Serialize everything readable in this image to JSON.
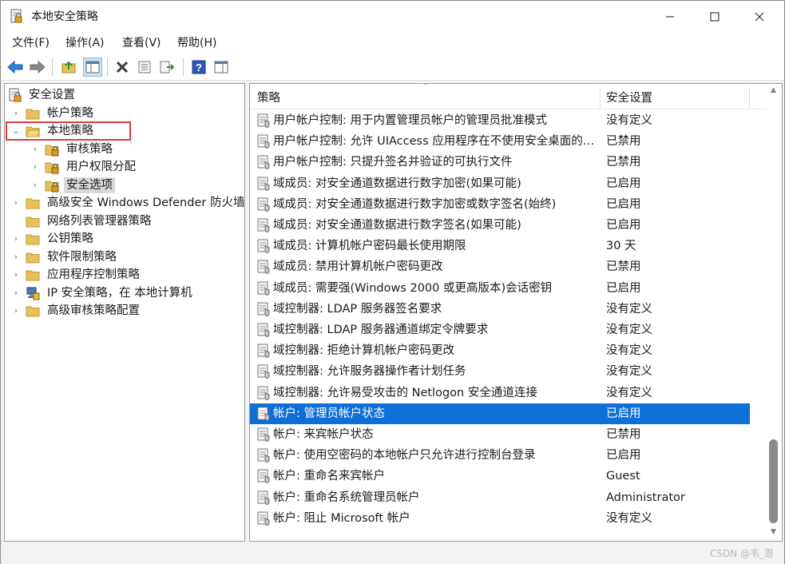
{
  "window": {
    "title": "本地安全策略"
  },
  "menu": [
    "文件(F)",
    "操作(A)",
    "查看(V)",
    "帮助(H)"
  ],
  "toolbar": {
    "icons": [
      "back-arrow-icon",
      "forward-arrow-icon",
      "up-folder-icon",
      "show-hide-tree-icon",
      "delete-icon",
      "properties-icon",
      "export-list-icon",
      "help-icon",
      "show-hide-action-pane-icon"
    ]
  },
  "tree": {
    "items": [
      {
        "label": "安全设置",
        "level": 0,
        "arrow": "",
        "icon": "security-settings-icon"
      },
      {
        "label": "帐户策略",
        "level": 1,
        "arrow": "›",
        "icon": "folder-icon"
      },
      {
        "label": "本地策略",
        "level": 1,
        "arrow": "⌄",
        "icon": "folder-open-icon"
      },
      {
        "label": "审核策略",
        "level": 2,
        "arrow": "›",
        "icon": "folder-locked-icon"
      },
      {
        "label": "用户权限分配",
        "level": 2,
        "arrow": "›",
        "icon": "folder-locked-icon"
      },
      {
        "label": "安全选项",
        "level": 2,
        "arrow": "›",
        "icon": "folder-locked-icon",
        "selected": true
      },
      {
        "label": "高级安全 Windows Defender 防火墙",
        "level": 1,
        "arrow": "›",
        "icon": "folder-icon"
      },
      {
        "label": "网络列表管理器策略",
        "level": 1,
        "arrow": "",
        "icon": "folder-icon"
      },
      {
        "label": "公钥策略",
        "level": 1,
        "arrow": "›",
        "icon": "folder-icon"
      },
      {
        "label": "软件限制策略",
        "level": 1,
        "arrow": "›",
        "icon": "folder-icon"
      },
      {
        "label": "应用程序控制策略",
        "level": 1,
        "arrow": "›",
        "icon": "folder-icon"
      },
      {
        "label": "IP 安全策略，在 本地计算机",
        "level": 1,
        "arrow": "›",
        "icon": "ip-security-icon"
      },
      {
        "label": "高级审核策略配置",
        "level": 1,
        "arrow": "›",
        "icon": "folder-icon"
      }
    ]
  },
  "list": {
    "columns": {
      "policy": "策略",
      "setting": "安全设置"
    },
    "rows": [
      {
        "policy": "用户帐户控制: 用于内置管理员帐户的管理员批准模式",
        "setting": "没有定义"
      },
      {
        "policy": "用户帐户控制: 允许 UIAccess 应用程序在不使用安全桌面的情况下提升权限",
        "setting": "已禁用"
      },
      {
        "policy": "用户帐户控制: 只提升签名并验证的可执行文件",
        "setting": "已禁用"
      },
      {
        "policy": "域成员: 对安全通道数据进行数字加密(如果可能)",
        "setting": "已启用"
      },
      {
        "policy": "域成员: 对安全通道数据进行数字加密或数字签名(始终)",
        "setting": "已启用"
      },
      {
        "policy": "域成员: 对安全通道数据进行数字签名(如果可能)",
        "setting": "已启用"
      },
      {
        "policy": "域成员: 计算机帐户密码最长使用期限",
        "setting": "30 天"
      },
      {
        "policy": "域成员: 禁用计算机帐户密码更改",
        "setting": "已禁用"
      },
      {
        "policy": "域成员: 需要强(Windows 2000 或更高版本)会话密钥",
        "setting": "已启用"
      },
      {
        "policy": "域控制器: LDAP 服务器签名要求",
        "setting": "没有定义"
      },
      {
        "policy": "域控制器: LDAP 服务器通道绑定令牌要求",
        "setting": "没有定义"
      },
      {
        "policy": "域控制器: 拒绝计算机帐户密码更改",
        "setting": "没有定义"
      },
      {
        "policy": "域控制器: 允许服务器操作者计划任务",
        "setting": "没有定义"
      },
      {
        "policy": "域控制器: 允许易受攻击的 Netlogon 安全通道连接",
        "setting": "没有定义"
      },
      {
        "policy": "帐户: 管理员帐户状态",
        "setting": "已启用",
        "selected": true
      },
      {
        "policy": "帐户: 来宾帐户状态",
        "setting": "已禁用"
      },
      {
        "policy": "帐户: 使用空密码的本地帐户只允许进行控制台登录",
        "setting": "已启用"
      },
      {
        "policy": "帐户: 重命名来宾帐户",
        "setting": "Guest"
      },
      {
        "policy": "帐户: 重命名系统管理员帐户",
        "setting": "Administrator"
      },
      {
        "policy": "帐户: 阻止 Microsoft 帐户",
        "setting": "没有定义"
      }
    ]
  },
  "status": {
    "watermark": "CSDN @韦_恩"
  },
  "colors": {
    "selection": "#0e6fd6",
    "highlight_box": "#e03a3a",
    "folder": "#e8c15a"
  }
}
